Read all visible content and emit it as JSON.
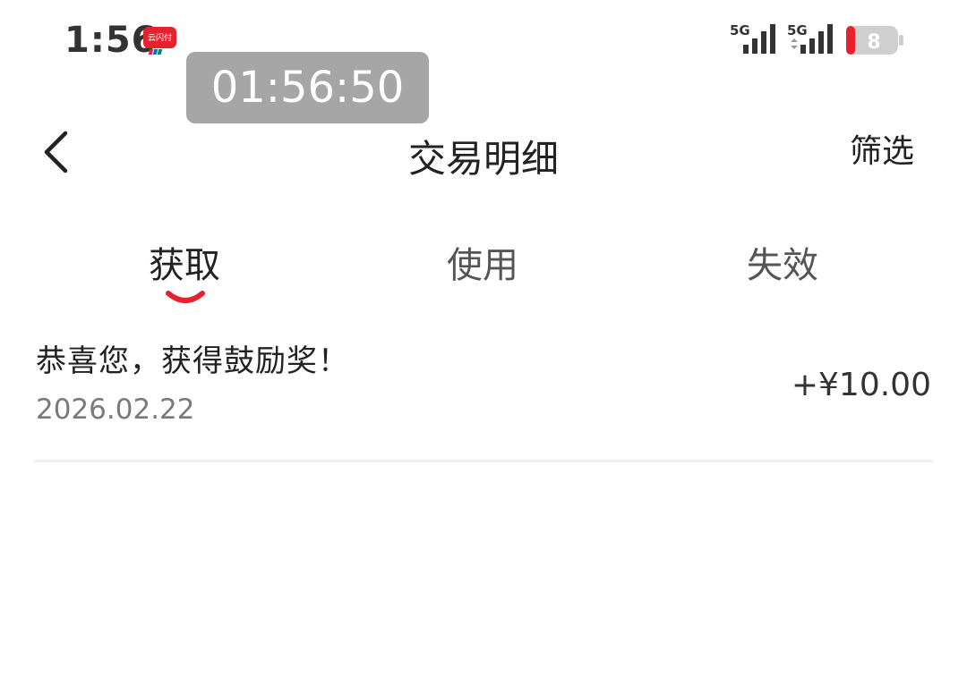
{
  "status_bar": {
    "time": "1:56",
    "timer_overlay": "01:56:50",
    "signal_1_label": "5G",
    "signal_2_label": "5G",
    "battery_level": "8",
    "app_icon_text": "云闪付"
  },
  "header": {
    "title": "交易明细",
    "filter_label": "筛选"
  },
  "tabs": [
    {
      "label": "获取",
      "active": true
    },
    {
      "label": "使用",
      "active": false
    },
    {
      "label": "失效",
      "active": false
    }
  ],
  "records": [
    {
      "title": "恭喜您，获得鼓励奖！",
      "date": "2026.02.22",
      "amount": "+¥10.00"
    }
  ],
  "colors": {
    "accent": "#e8212e",
    "battery_low": "#e8212e",
    "timer_bg": "#a6a6a6",
    "secondary_text": "#7a7a7a"
  }
}
